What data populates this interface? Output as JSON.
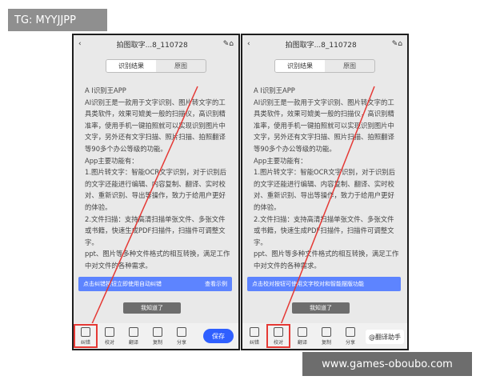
{
  "tag": "TG: MYYJJPP",
  "watermark": "www.games-oboubo.com",
  "phones": {
    "left": {
      "title": "拍图取字...8_110728",
      "tabs": [
        "识别结果",
        "原图"
      ],
      "content": [
        "A I识别王APP",
        "AI识别王是一款用于文字识别、图片转文字的工具类软件，效果可媲美一般的扫描仪，高识别精准率，使用手机一键拍照就可以实现识别图片中文字，另外还有文字扫描、照片扫描、拍照翻译等90多个办公等级的功能。",
        "App主要功能有：",
        "1.图片转文字：智能OCR文字识别，对于识别后的文字还能进行编辑、内容复制、翻译、实时校对、重新识别、导出等操作，致力于给用户更好的体验。",
        "2.文件扫描：支持高清扫描单张文件、多张文件或书籍，快速生成PDF扫描件，扫描件可调整文字。",
        "ppt、图片等多种文件格式的相互转换，满足工作中对文件的各种需求。"
      ],
      "banner": "点击纠错按钮立即使用自动纠错",
      "banner_action": "查看示例",
      "toast": "我知道了",
      "tools": [
        "纠错",
        "校对",
        "翻译",
        "复制",
        "分享"
      ],
      "save": "保存"
    },
    "right": {
      "title": "拍图取字...8_110728",
      "tabs": [
        "识别结果",
        "原图"
      ],
      "content": [
        "A I识别王APP",
        "AI识别王是一款用于文字识别、图片转文字的工具类软件，效果可媲美一般的扫描仪，高识别精准率，使用手机一键拍照就可以实现识别图片中文字，另外还有文字扫描、照片扫描、拍照翻译等90多个办公等级的功能。",
        "App主要功能有：",
        "1.图片转文字：智能OCR文字识别，对于识别后的文字还能进行编辑、内容复制、翻译、实时校对、重新识别、导出等操作，致力于给用户更好的体验。",
        "2.文件扫描：支持高清扫描单张文件、多张文件或书籍，快速生成PDF扫描件，扫描件可调整文字。",
        "ppt、图片等多种文件格式的相互转换，满足工作中对文件的各种需求。"
      ],
      "banner": "点击校对按钮可使用文字校对和智能摆版功能",
      "toast": "我知道了",
      "tools": [
        "纠错",
        "校对",
        "翻译",
        "复制",
        "分享"
      ],
      "credit": "@翻译助手"
    }
  },
  "colors": {
    "accent": "#5d84ff",
    "highlight": "#e53935",
    "phone_bg": "#e9e9e9"
  }
}
